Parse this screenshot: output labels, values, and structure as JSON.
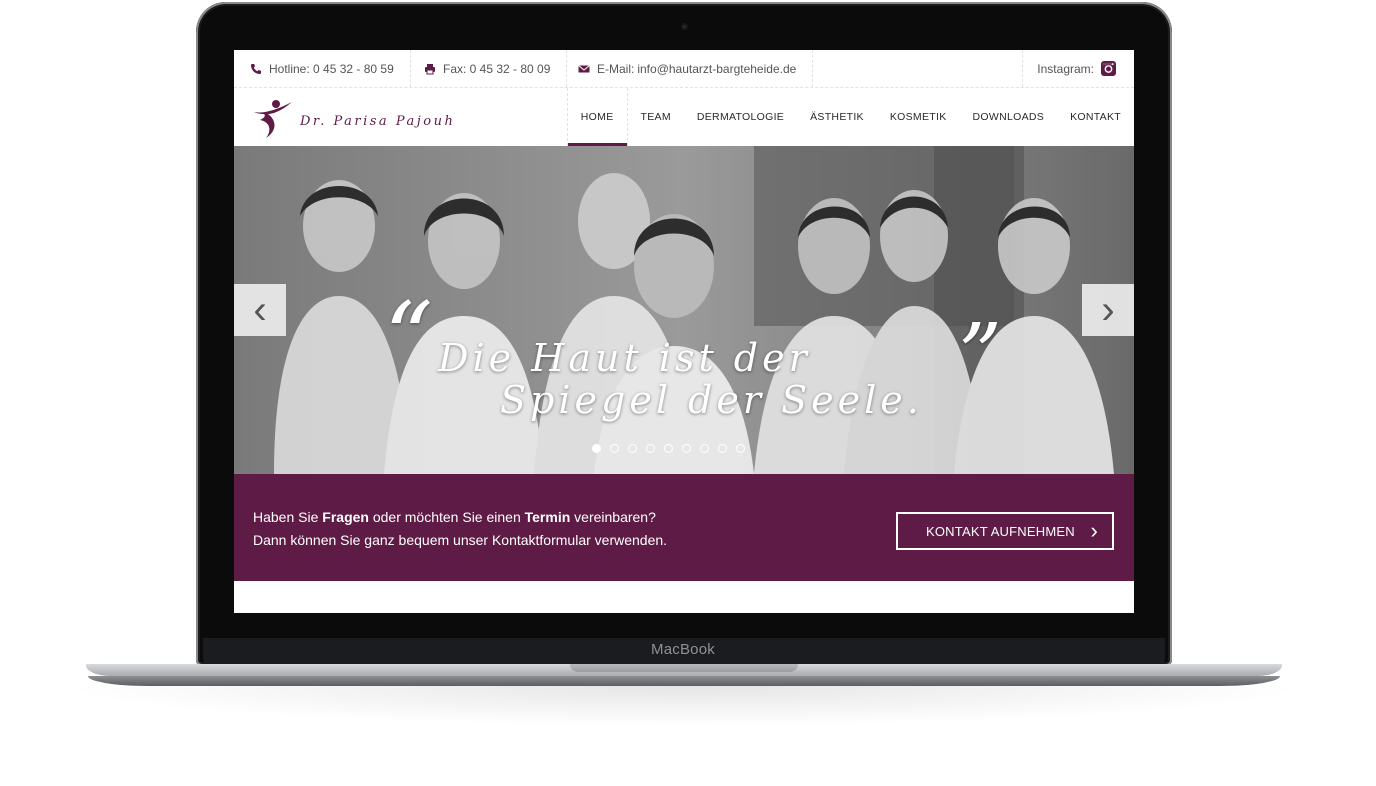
{
  "device": {
    "brand": "MacBook"
  },
  "topbar": {
    "hotline": "Hotline: 0 45 32 - 80 59",
    "fax": "Fax: 0 45 32 - 80 09",
    "email_label": "E-Mail:",
    "email": "info@hautarzt-bargteheide.de",
    "instagram": "Instagram:"
  },
  "header": {
    "logo_text": "Dr. Parisa Pajouh",
    "nav": [
      "HOME",
      "TEAM",
      "DERMATOLOGIE",
      "ÄSTHETIK",
      "KOSMETIK",
      "DOWNLOADS",
      "KONTAKT"
    ],
    "active_nav": "HOME"
  },
  "hero": {
    "quote_line1": "Die Haut ist der",
    "quote_line2": "Spiegel der Seele.",
    "quote_open": "“",
    "quote_close": "”",
    "slide_count": 9,
    "active_slide": 1,
    "prev_symbol": "‹",
    "next_symbol": "›"
  },
  "cta": {
    "line1_a": "Haben Sie ",
    "line1_b": "Fragen",
    "line1_c": " oder möchten Sie einen ",
    "line1_d": "Termin",
    "line1_e": " vereinbaren?",
    "line2": "Dann können Sie ganz bequem unser Kontaktformular verwenden.",
    "button": "KONTAKT AUFNEHMEN",
    "button_arrow": "›"
  },
  "colors": {
    "brand": "#5e1b45",
    "laptop_bezel": "#0b0b0c"
  }
}
